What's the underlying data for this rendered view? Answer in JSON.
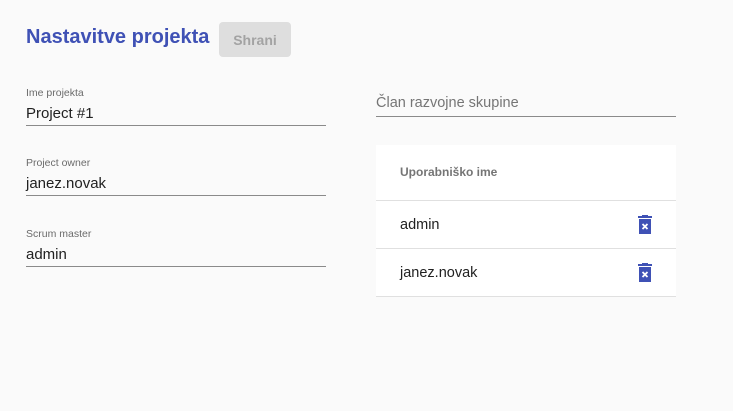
{
  "header": {
    "title": "Nastavitve projekta",
    "save_label": "Shrani"
  },
  "fields": [
    {
      "label": "Ime projekta",
      "value": "Project #1"
    },
    {
      "label": "Project owner",
      "value": "janez.novak"
    },
    {
      "label": "Scrum master",
      "value": "admin"
    }
  ],
  "member_input": {
    "placeholder": "Član razvojne skupine"
  },
  "table": {
    "header": "Uporabniško ime",
    "rows": [
      {
        "username": "admin",
        "action_icon": "delete-icon"
      },
      {
        "username": "janez.novak",
        "action_icon": "delete-icon"
      }
    ]
  },
  "colors": {
    "accent": "#3f51b5"
  }
}
